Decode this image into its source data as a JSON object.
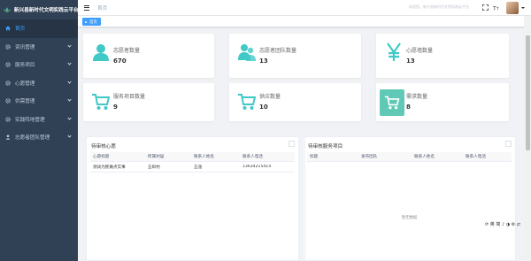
{
  "app": {
    "title": "新兴县新时代文明实践云平台"
  },
  "sidebar": {
    "items": [
      {
        "label": "首页",
        "active": true,
        "icon": "home-icon"
      },
      {
        "label": "资讯管理",
        "icon": "gear-icon"
      },
      {
        "label": "服务项目",
        "icon": "gear-icon"
      },
      {
        "label": "心愿管理",
        "icon": "gear-icon"
      },
      {
        "label": "供需管理",
        "icon": "gear-icon"
      },
      {
        "label": "实践阵地管理",
        "icon": "gear-icon"
      },
      {
        "label": "志愿者团队管理",
        "icon": "user-icon"
      }
    ]
  },
  "header": {
    "breadcrumb": "首页",
    "welcome": "欢迎您，新兴县新时代文明实践云平台"
  },
  "tags": {
    "home": "首页"
  },
  "stats": [
    {
      "label": "志愿者数量",
      "value": "670",
      "icon": "user-icon"
    },
    {
      "label": "志愿者团队数量",
      "value": "13",
      "icon": "team-icon"
    },
    {
      "label": "心愿墙数量",
      "value": "13",
      "icon": "yen-icon"
    },
    {
      "label": "服务项目数量",
      "value": "9",
      "icon": "cart-icon"
    },
    {
      "label": "供应数量",
      "value": "10",
      "icon": "cart-icon"
    },
    {
      "label": "需求数量",
      "value": "8",
      "icon": "cart-icon"
    }
  ],
  "wishes_panel": {
    "title": "待审核心愿",
    "columns": [
      "心愿标题",
      "所属村居",
      "联系人姓名",
      "联系人电话"
    ],
    "rows": [
      [
        "测试为民做点实事",
        "五圳村",
        "五涨",
        "13634215414"
      ]
    ]
  },
  "services_panel": {
    "title": "待审核服务项目",
    "columns": [
      "标题",
      "发布团队",
      "联系人姓名",
      "联系人电话"
    ],
    "empty_text": "暂无数据"
  },
  "float_toolbar": {
    "text": "⟳ 英 简 ♪ ◑ ⚙ ⇄"
  },
  "colors": {
    "accent": "#409eff",
    "sidebar": "#304156",
    "icon_teal": "#5fc9b5"
  }
}
